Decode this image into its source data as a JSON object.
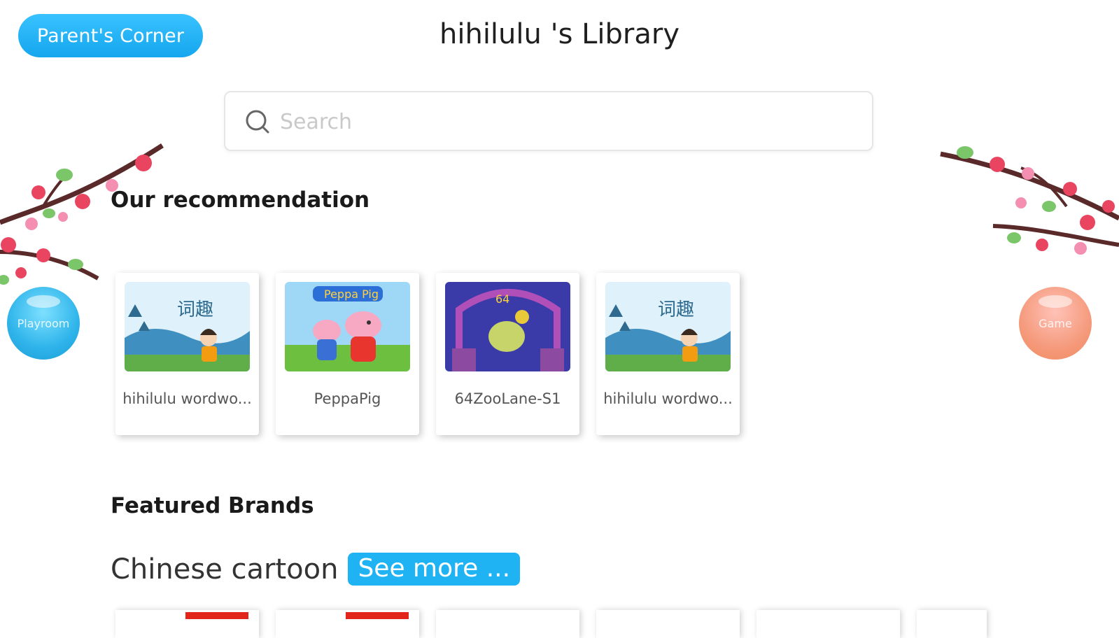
{
  "header": {
    "parents_corner_label": "Parent's Corner",
    "library_title": "hihilulu 's Library"
  },
  "search": {
    "placeholder": "Search"
  },
  "sections": {
    "recommendation_title": "Our recommendation",
    "featured_title": "Featured Brands"
  },
  "recommendations": [
    {
      "caption": "hihilulu wordwo...",
      "thumb": "wordworld"
    },
    {
      "caption": "PeppaPig",
      "thumb": "peppa"
    },
    {
      "caption": "64ZooLane-S1",
      "thumb": "zoolane"
    },
    {
      "caption": "hihilulu wordwo...",
      "thumb": "wordworld"
    }
  ],
  "side_buttons": {
    "left_label": "Playroom",
    "right_label": "Game"
  },
  "featured": {
    "category_label": "Chinese cartoon",
    "see_more_label": "See more ..."
  },
  "colors": {
    "accent_blue": "#1fb3f3",
    "playroom_blue": "#2eb4ea",
    "game_orange": "#f59a7c",
    "blossom_pink": "#e94560"
  }
}
